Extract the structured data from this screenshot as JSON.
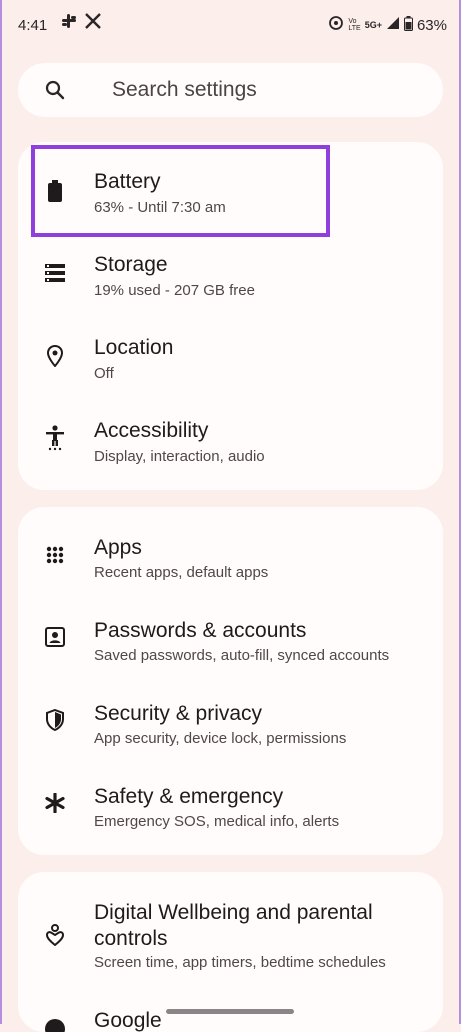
{
  "status_bar": {
    "time": "4:41",
    "network_vo": "Vo",
    "network_lte": "LTE",
    "network_5g": "5G+",
    "battery_percent": "63%"
  },
  "search": {
    "placeholder": "Search settings"
  },
  "groups": [
    {
      "items": [
        {
          "icon": "battery-icon",
          "title": "Battery",
          "subtitle": "63% - Until 7:30 am"
        },
        {
          "icon": "storage-icon",
          "title": "Storage",
          "subtitle": "19% used - 207 GB free"
        },
        {
          "icon": "location-pin-icon",
          "title": "Location",
          "subtitle": "Off"
        },
        {
          "icon": "accessibility-icon",
          "title": "Accessibility",
          "subtitle": "Display, interaction, audio"
        }
      ]
    },
    {
      "items": [
        {
          "icon": "apps-grid-icon",
          "title": "Apps",
          "subtitle": "Recent apps, default apps"
        },
        {
          "icon": "account-box-icon",
          "title": "Passwords & accounts",
          "subtitle": "Saved passwords, auto-fill, synced accounts"
        },
        {
          "icon": "shield-icon",
          "title": "Security & privacy",
          "subtitle": "App security, device lock, permissions"
        },
        {
          "icon": "asterisk-icon",
          "title": "Safety & emergency",
          "subtitle": "Emergency SOS, medical info, alerts"
        }
      ]
    },
    {
      "items": [
        {
          "icon": "wellbeing-icon",
          "title_line1": "Digital Wellbeing and parental",
          "title_line2": "controls",
          "subtitle": "Screen time, app timers, bedtime schedules"
        },
        {
          "icon": "google-icon",
          "title": "Google"
        }
      ]
    }
  ],
  "colors": {
    "background": "#fbeeeb",
    "card": "#fffcfb",
    "highlight": "#8e3fdc"
  }
}
